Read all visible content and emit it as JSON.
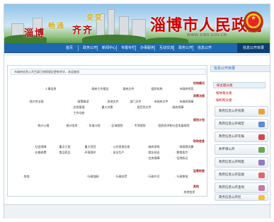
{
  "banner": {
    "calli_left": "淄博",
    "calli_left_2": "畅通",
    "calli_mid": "齐齐",
    "calli_mid_2": "变变",
    "gov_title": "淄博市人民政府",
    "gov_url": "WWW.ZIBO.GOV.CN",
    "emblem": "national-emblem"
  },
  "nav": {
    "items": [
      "首页",
      "政务公开",
      "新闻中心",
      "专题专栏",
      "办事服务",
      "互动交流",
      "政务公开",
      "信息公开",
      "魅力淄博"
    ],
    "right_label": "信息公开目录"
  },
  "main": {
    "notice": "市政府信息公开目录已按照规定更新完毕，欢迎查阅",
    "sections": [
      {
        "title": "机构概况",
        "items": [
          "市政府领导",
          "组织机构",
          "政府文件",
          "政府工作报告",
          "人事信息",
          "政府会议",
          "规范性文件"
        ]
      },
      {
        "title": "政策法规",
        "items": [
          "市政府规章",
          "市政府文件",
          "部门文件",
          "其他文件",
          "政策解读",
          "地方性法规",
          "政府规章",
          "规范性文件",
          "重大决策",
          "应急管理",
          "工作动态"
        ]
      },
      {
        "title": "规划计划",
        "items": [
          "国民经济和社会发展规划",
          "专项规划",
          "区域规划",
          "年度计划",
          "统计信息",
          "统计公报"
        ]
      },
      {
        "title": "财政信息",
        "items": [
          "财政预决算",
          "政府采购",
          "公共资源交易",
          "重大项目",
          "重点工程",
          "社会保障",
          "教育医疗",
          "就业创业",
          "安全生产",
          "环境保护",
          "食品药品",
          "价格收费",
          "征地拆迁",
          "住房保障"
        ]
      },
      {
        "title": "监督检查",
        "items": [
          "行政审批",
          "行政许可",
          "行政处罚",
          "行政强制",
          "其他"
        ]
      },
      {
        "title": "其他",
        "items": [
          "其他信息"
        ]
      }
    ]
  },
  "sidebar": {
    "head": "信息公开目录",
    "tabs": [
      "按主题分类",
      "按体裁分类",
      "按机构分类"
    ],
    "buttons": [
      "政府信息公开指南",
      "政府信息公开规定",
      "政府信息公开年报",
      "依申请公开",
      "政府信息公开制度",
      "政府信息公开监督",
      "政府信息公开查询",
      "政务信息公开栏"
    ]
  }
}
